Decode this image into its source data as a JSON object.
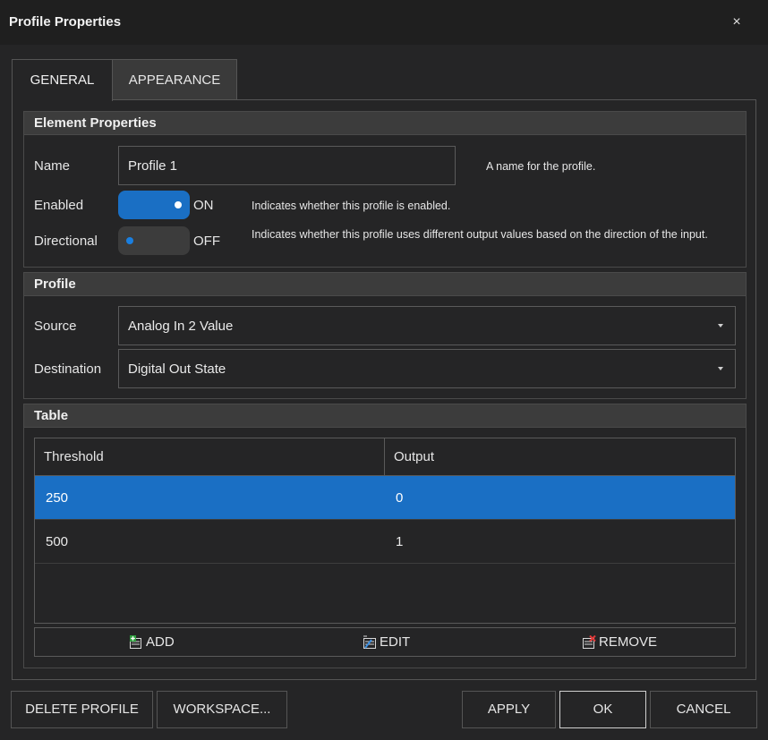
{
  "window": {
    "title": "Profile Properties",
    "close_glyph": "×"
  },
  "tabs": [
    {
      "label": "GENERAL",
      "active": true
    },
    {
      "label": "APPEARANCE",
      "active": false
    }
  ],
  "element_properties": {
    "header": "Element Properties",
    "name": {
      "label": "Name",
      "value": "Profile 1",
      "description": "A name for the profile."
    },
    "enabled": {
      "label": "Enabled",
      "state": "ON",
      "on": true,
      "description": "Indicates whether this profile is enabled."
    },
    "directional": {
      "label": "Directional",
      "state": "OFF",
      "on": false,
      "description": "Indicates whether this profile uses different output values based on the direction of the input."
    }
  },
  "profile": {
    "header": "Profile",
    "source": {
      "label": "Source",
      "value": "Analog In 2 Value"
    },
    "destination": {
      "label": "Destination",
      "value": "Digital Out State"
    }
  },
  "table": {
    "header": "Table",
    "columns": [
      "Threshold",
      "Output"
    ],
    "rows": [
      {
        "threshold": "250",
        "output": "0",
        "selected": true
      },
      {
        "threshold": "500",
        "output": "1",
        "selected": false
      }
    ],
    "buttons": {
      "add": "ADD",
      "edit": "EDIT",
      "remove": "REMOVE"
    }
  },
  "footer": {
    "delete_profile": "DELETE PROFILE",
    "workspace": "WORKSPACE...",
    "apply": "APPLY",
    "ok": "OK",
    "cancel": "CANCEL"
  },
  "colors": {
    "accent": "#1a6fc4",
    "background": "#252526",
    "titlebar": "#1f1f1f",
    "group_header": "#3c3c3c"
  }
}
